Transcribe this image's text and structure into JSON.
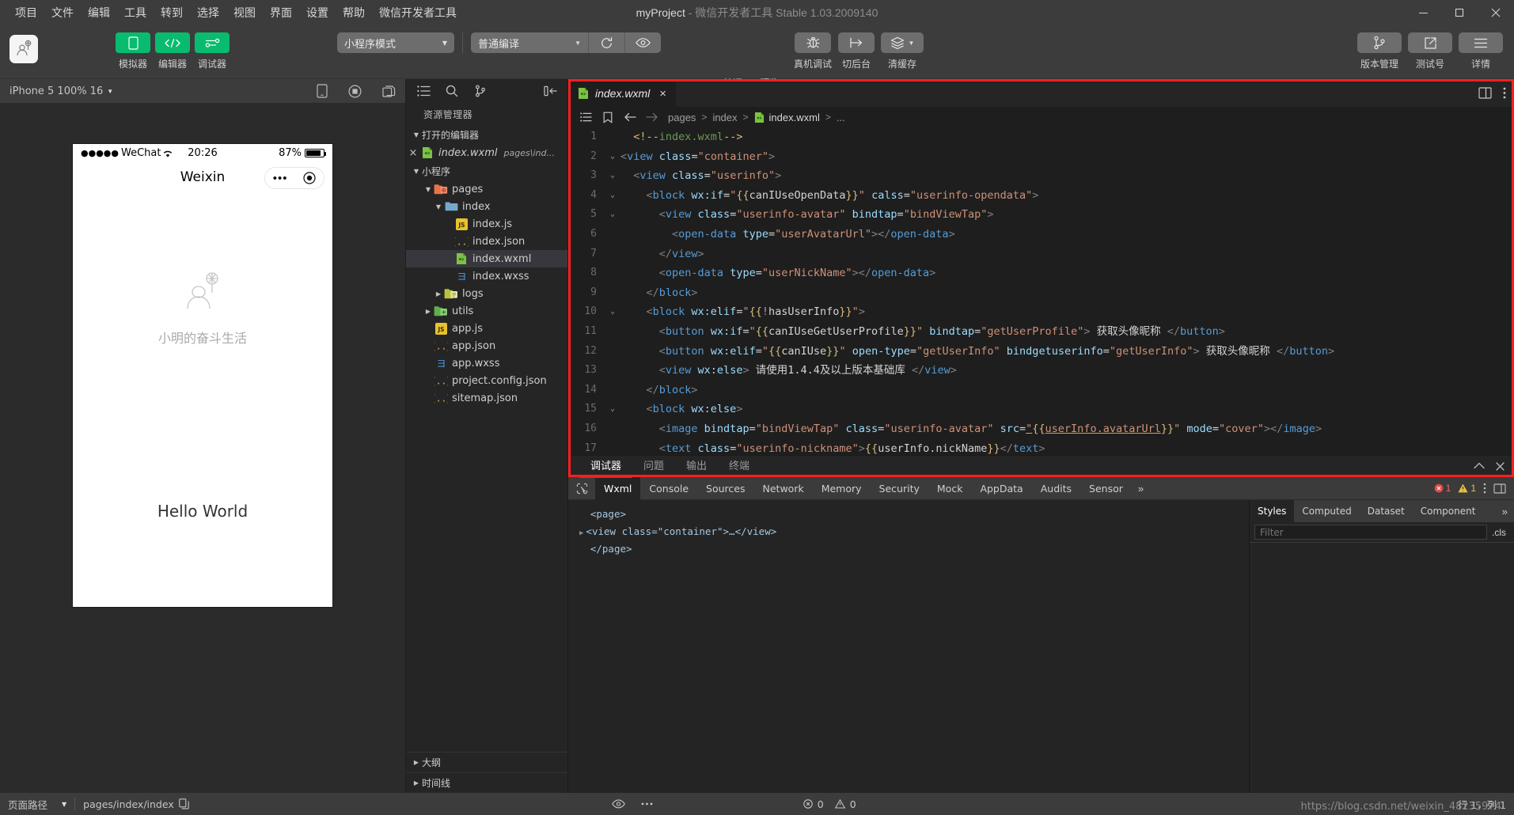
{
  "titlebar": {
    "menus": [
      "项目",
      "文件",
      "编辑",
      "工具",
      "转到",
      "选择",
      "视图",
      "界面",
      "设置",
      "帮助",
      "微信开发者工具"
    ],
    "project_name": "myProject",
    "dash": "-",
    "app_version": "微信开发者工具 Stable 1.03.2009140",
    "window_controls": {
      "minimize": "minimize-icon",
      "maximize": "maximize-icon",
      "close": "close-icon"
    }
  },
  "toolbar": {
    "logo": "project-avatar-icon",
    "modes": [
      {
        "label": "模拟器",
        "icon": "phone-icon"
      },
      {
        "label": "编辑器",
        "icon": "code-icon"
      },
      {
        "label": "调试器",
        "icon": "sliders-icon"
      }
    ],
    "mode_select": "小程序模式",
    "compile_select": "普通编译",
    "actions": [
      {
        "label": "编译",
        "icon": "refresh-icon"
      },
      {
        "label": "预览",
        "icon": "eye-icon"
      },
      {
        "label": "真机调试",
        "icon": "bug-icon"
      },
      {
        "label": "切后台",
        "icon": "background-icon"
      },
      {
        "label": "清缓存",
        "icon": "layers-icon"
      }
    ],
    "right_actions": [
      {
        "label": "版本管理",
        "icon": "branch-icon"
      },
      {
        "label": "测试号",
        "icon": "external-link-icon"
      },
      {
        "label": "详情",
        "icon": "menu-lines-icon"
      }
    ]
  },
  "simulator": {
    "device_label": "iPhone 5 100% 16",
    "icons": [
      "rotate-device-icon",
      "record-icon"
    ],
    "phone": {
      "status_dots": "●●●●●",
      "carrier": "WeChat",
      "wifi": "wifi-icon",
      "time": "20:26",
      "battery_percent": "87%",
      "nav_title": "Weixin",
      "capsule_more": "•••",
      "capsule_target": "target-icon",
      "nickname": "小明的奋斗生活",
      "body_text": "Hello World"
    }
  },
  "explorer": {
    "toolbar_icons": [
      "list-icon",
      "search-icon",
      "branch-icon",
      "collapse-icon"
    ],
    "title": "资源管理器",
    "open_editors": {
      "label": "打开的编辑器",
      "items": [
        {
          "name": "index.wxml",
          "path": "pages\\ind...",
          "icon": "wxml-icon",
          "close": "×"
        }
      ]
    },
    "project": {
      "label": "小程序",
      "tree": [
        {
          "name": "pages",
          "type": "folder-pages",
          "depth": 1,
          "expanded": true
        },
        {
          "name": "index",
          "type": "folder",
          "depth": 2,
          "expanded": true
        },
        {
          "name": "index.js",
          "type": "js",
          "depth": 3
        },
        {
          "name": "index.json",
          "type": "json",
          "depth": 3
        },
        {
          "name": "index.wxml",
          "type": "wxml",
          "depth": 3,
          "active": true
        },
        {
          "name": "index.wxss",
          "type": "wxss",
          "depth": 3
        },
        {
          "name": "logs",
          "type": "folder-logs",
          "depth": 2,
          "expanded": false
        },
        {
          "name": "utils",
          "type": "folder-utils",
          "depth": 1,
          "expanded": false
        },
        {
          "name": "app.js",
          "type": "js",
          "depth": 1
        },
        {
          "name": "app.json",
          "type": "json",
          "depth": 1
        },
        {
          "name": "app.wxss",
          "type": "wxss",
          "depth": 1
        },
        {
          "name": "project.config.json",
          "type": "json",
          "depth": 1
        },
        {
          "name": "sitemap.json",
          "type": "json",
          "depth": 1
        }
      ]
    },
    "bottom_sections": [
      "大纲",
      "时间线"
    ]
  },
  "editor": {
    "tab": {
      "name": "index.wxml",
      "icon": "wxml-icon",
      "close": "×"
    },
    "tab_actions": [
      "split-editor-icon",
      "more-icon"
    ],
    "breadcrumb": {
      "icons": [
        "outline-icon",
        "bookmark-icon",
        "back-arrow-icon",
        "forward-arrow-icon"
      ],
      "parts": [
        "pages",
        "index",
        "index.wxml",
        "..."
      ]
    },
    "lines": [
      {
        "n": "1",
        "fold": "",
        "tokens": [
          {
            "t": "  ",
            "c": "t-txt"
          },
          {
            "t": "<!--",
            "c": "t-com-b"
          },
          {
            "t": "index.wxml",
            "c": "t-com"
          },
          {
            "t": "-->",
            "c": "t-com-b"
          }
        ]
      },
      {
        "n": "2",
        "fold": "v",
        "tokens": [
          {
            "t": "<",
            "c": "t-pun"
          },
          {
            "t": "view",
            "c": "t-tag"
          },
          {
            "t": " class",
            "c": "t-attr"
          },
          {
            "t": "=",
            "c": "t-eq"
          },
          {
            "t": "\"container\"",
            "c": "t-str"
          },
          {
            "t": ">",
            "c": "t-pun"
          }
        ]
      },
      {
        "n": "3",
        "fold": "v",
        "tokens": [
          {
            "t": "  <",
            "c": "t-pun"
          },
          {
            "t": "view",
            "c": "t-tag"
          },
          {
            "t": " class",
            "c": "t-attr"
          },
          {
            "t": "=",
            "c": "t-eq"
          },
          {
            "t": "\"userinfo\"",
            "c": "t-str"
          },
          {
            "t": ">",
            "c": "t-pun"
          }
        ]
      },
      {
        "n": "4",
        "fold": "v",
        "tokens": [
          {
            "t": "    <",
            "c": "t-pun"
          },
          {
            "t": "block",
            "c": "t-tag"
          },
          {
            "t": " wx:if",
            "c": "t-attr"
          },
          {
            "t": "=",
            "c": "t-eq"
          },
          {
            "t": "\"",
            "c": "t-str"
          },
          {
            "t": "{{",
            "c": "t-brace"
          },
          {
            "t": "canIUseOpenData",
            "c": "t-txt"
          },
          {
            "t": "}}",
            "c": "t-brace"
          },
          {
            "t": "\"",
            "c": "t-str"
          },
          {
            "t": " calss",
            "c": "t-attr"
          },
          {
            "t": "=",
            "c": "t-eq"
          },
          {
            "t": "\"userinfo-opendata\"",
            "c": "t-str"
          },
          {
            "t": ">",
            "c": "t-pun"
          }
        ]
      },
      {
        "n": "5",
        "fold": "v",
        "tokens": [
          {
            "t": "      <",
            "c": "t-pun"
          },
          {
            "t": "view",
            "c": "t-tag"
          },
          {
            "t": " class",
            "c": "t-attr"
          },
          {
            "t": "=",
            "c": "t-eq"
          },
          {
            "t": "\"userinfo-avatar\"",
            "c": "t-str"
          },
          {
            "t": " bindtap",
            "c": "t-attr"
          },
          {
            "t": "=",
            "c": "t-eq"
          },
          {
            "t": "\"bindViewTap\"",
            "c": "t-str"
          },
          {
            "t": ">",
            "c": "t-pun"
          }
        ]
      },
      {
        "n": "6",
        "fold": "",
        "tokens": [
          {
            "t": "        <",
            "c": "t-pun"
          },
          {
            "t": "open-data",
            "c": "t-tag"
          },
          {
            "t": " type",
            "c": "t-attr"
          },
          {
            "t": "=",
            "c": "t-eq"
          },
          {
            "t": "\"userAvatarUrl\"",
            "c": "t-str"
          },
          {
            "t": "></",
            "c": "t-pun"
          },
          {
            "t": "open-data",
            "c": "t-tag"
          },
          {
            "t": ">",
            "c": "t-pun"
          }
        ]
      },
      {
        "n": "7",
        "fold": "",
        "tokens": [
          {
            "t": "      </",
            "c": "t-pun"
          },
          {
            "t": "view",
            "c": "t-tag"
          },
          {
            "t": ">",
            "c": "t-pun"
          }
        ]
      },
      {
        "n": "8",
        "fold": "",
        "tokens": [
          {
            "t": "      <",
            "c": "t-pun"
          },
          {
            "t": "open-data",
            "c": "t-tag"
          },
          {
            "t": " type",
            "c": "t-attr"
          },
          {
            "t": "=",
            "c": "t-eq"
          },
          {
            "t": "\"userNickName\"",
            "c": "t-str"
          },
          {
            "t": "></",
            "c": "t-pun"
          },
          {
            "t": "open-data",
            "c": "t-tag"
          },
          {
            "t": ">",
            "c": "t-pun"
          }
        ]
      },
      {
        "n": "9",
        "fold": "",
        "tokens": [
          {
            "t": "    </",
            "c": "t-pun"
          },
          {
            "t": "block",
            "c": "t-tag"
          },
          {
            "t": ">",
            "c": "t-pun"
          }
        ]
      },
      {
        "n": "10",
        "fold": "v",
        "tokens": [
          {
            "t": "    <",
            "c": "t-pun"
          },
          {
            "t": "block",
            "c": "t-tag"
          },
          {
            "t": " wx:elif",
            "c": "t-attr"
          },
          {
            "t": "=",
            "c": "t-eq"
          },
          {
            "t": "\"",
            "c": "t-str"
          },
          {
            "t": "{{",
            "c": "t-brace"
          },
          {
            "t": "!",
            "c": "t-var"
          },
          {
            "t": "hasUserInfo",
            "c": "t-txt"
          },
          {
            "t": "}}",
            "c": "t-brace"
          },
          {
            "t": "\"",
            "c": "t-str"
          },
          {
            "t": ">",
            "c": "t-pun"
          }
        ]
      },
      {
        "n": "11",
        "fold": "",
        "tokens": [
          {
            "t": "      <",
            "c": "t-pun"
          },
          {
            "t": "button",
            "c": "t-tag"
          },
          {
            "t": " wx:if",
            "c": "t-attr"
          },
          {
            "t": "=",
            "c": "t-eq"
          },
          {
            "t": "\"",
            "c": "t-str"
          },
          {
            "t": "{{",
            "c": "t-brace"
          },
          {
            "t": "canIUseGetUserProfile",
            "c": "t-txt"
          },
          {
            "t": "}}",
            "c": "t-brace"
          },
          {
            "t": "\"",
            "c": "t-str"
          },
          {
            "t": " bindtap",
            "c": "t-attr"
          },
          {
            "t": "=",
            "c": "t-eq"
          },
          {
            "t": "\"getUserProfile\"",
            "c": "t-str"
          },
          {
            "t": ">",
            "c": "t-pun"
          },
          {
            "t": " 获取头像昵称 ",
            "c": "t-txt"
          },
          {
            "t": "</",
            "c": "t-pun"
          },
          {
            "t": "button",
            "c": "t-tag"
          },
          {
            "t": ">",
            "c": "t-pun"
          }
        ]
      },
      {
        "n": "12",
        "fold": "",
        "tokens": [
          {
            "t": "      <",
            "c": "t-pun"
          },
          {
            "t": "button",
            "c": "t-tag"
          },
          {
            "t": " wx:elif",
            "c": "t-attr"
          },
          {
            "t": "=",
            "c": "t-eq"
          },
          {
            "t": "\"",
            "c": "t-str"
          },
          {
            "t": "{{",
            "c": "t-brace"
          },
          {
            "t": "canIUse",
            "c": "t-txt"
          },
          {
            "t": "}}",
            "c": "t-brace"
          },
          {
            "t": "\"",
            "c": "t-str"
          },
          {
            "t": " open-type",
            "c": "t-attr"
          },
          {
            "t": "=",
            "c": "t-eq"
          },
          {
            "t": "\"getUserInfo\"",
            "c": "t-str"
          },
          {
            "t": " bindgetuserinfo",
            "c": "t-attr"
          },
          {
            "t": "=",
            "c": "t-eq"
          },
          {
            "t": "\"getUserInfo\"",
            "c": "t-str"
          },
          {
            "t": ">",
            "c": "t-pun"
          },
          {
            "t": " 获取头像昵称 ",
            "c": "t-txt"
          },
          {
            "t": "</",
            "c": "t-pun"
          },
          {
            "t": "button",
            "c": "t-tag"
          },
          {
            "t": ">",
            "c": "t-pun"
          }
        ]
      },
      {
        "n": "13",
        "fold": "",
        "tokens": [
          {
            "t": "      <",
            "c": "t-pun"
          },
          {
            "t": "view",
            "c": "t-tag"
          },
          {
            "t": " wx:else",
            "c": "t-attr"
          },
          {
            "t": ">",
            "c": "t-pun"
          },
          {
            "t": " 请使用1.4.4及以上版本基础库 ",
            "c": "t-txt"
          },
          {
            "t": "</",
            "c": "t-pun"
          },
          {
            "t": "view",
            "c": "t-tag"
          },
          {
            "t": ">",
            "c": "t-pun"
          }
        ]
      },
      {
        "n": "14",
        "fold": "",
        "tokens": [
          {
            "t": "    </",
            "c": "t-pun"
          },
          {
            "t": "block",
            "c": "t-tag"
          },
          {
            "t": ">",
            "c": "t-pun"
          }
        ]
      },
      {
        "n": "15",
        "fold": "v",
        "tokens": [
          {
            "t": "    <",
            "c": "t-pun"
          },
          {
            "t": "block",
            "c": "t-tag"
          },
          {
            "t": " wx:else",
            "c": "t-attr"
          },
          {
            "t": ">",
            "c": "t-pun"
          }
        ]
      },
      {
        "n": "16",
        "fold": "",
        "tokens": [
          {
            "t": "      <",
            "c": "t-pun"
          },
          {
            "t": "image",
            "c": "t-tag"
          },
          {
            "t": " bindtap",
            "c": "t-attr"
          },
          {
            "t": "=",
            "c": "t-eq"
          },
          {
            "t": "\"bindViewTap\"",
            "c": "t-str"
          },
          {
            "t": " class",
            "c": "t-attr"
          },
          {
            "t": "=",
            "c": "t-eq"
          },
          {
            "t": "\"userinfo-avatar\"",
            "c": "t-str"
          },
          {
            "t": " src",
            "c": "t-attr"
          },
          {
            "t": "=",
            "c": "t-eq"
          },
          {
            "t": "\"",
            "c": "t-link"
          },
          {
            "t": "{{",
            "c": "t-brace"
          },
          {
            "t": "userInfo.avatarUrl",
            "c": "t-link"
          },
          {
            "t": "}}",
            "c": "t-brace"
          },
          {
            "t": "\"",
            "c": "t-str"
          },
          {
            "t": " mode",
            "c": "t-attr"
          },
          {
            "t": "=",
            "c": "t-eq"
          },
          {
            "t": "\"cover\"",
            "c": "t-str"
          },
          {
            "t": "></",
            "c": "t-pun"
          },
          {
            "t": "image",
            "c": "t-tag"
          },
          {
            "t": ">",
            "c": "t-pun"
          }
        ]
      },
      {
        "n": "17",
        "fold": "",
        "tokens": [
          {
            "t": "      <",
            "c": "t-pun"
          },
          {
            "t": "text",
            "c": "t-tag"
          },
          {
            "t": " class",
            "c": "t-attr"
          },
          {
            "t": "=",
            "c": "t-eq"
          },
          {
            "t": "\"userinfo-nickname\"",
            "c": "t-str"
          },
          {
            "t": ">",
            "c": "t-pun"
          },
          {
            "t": "{{",
            "c": "t-brace"
          },
          {
            "t": "userInfo.nickName",
            "c": "t-txt"
          },
          {
            "t": "}}",
            "c": "t-brace"
          },
          {
            "t": "</",
            "c": "t-pun"
          },
          {
            "t": "text",
            "c": "t-tag"
          },
          {
            "t": ">",
            "c": "t-pun"
          }
        ]
      }
    ]
  },
  "panel": {
    "tabs": [
      "调试器",
      "问题",
      "输出",
      "终端"
    ],
    "active_tab": "调试器",
    "actions": [
      "chevron-up-icon",
      "close-icon"
    ]
  },
  "devtools": {
    "inspect_icon": "inspect-element-icon",
    "tabs": [
      "Wxml",
      "Console",
      "Sources",
      "Network",
      "Memory",
      "Security",
      "Mock",
      "AppData",
      "Audits",
      "Sensor"
    ],
    "active_tab": "Wxml",
    "overflow": "»",
    "error_count": "1",
    "warning_count": "1",
    "more_icon": "kebab-icon",
    "dock_icon": "dock-icon",
    "dom": [
      {
        "indent": 0,
        "arrow": "",
        "text": "<page>",
        "cls": "t-tag"
      },
      {
        "indent": 0,
        "arrow": "▶",
        "text": "<view class=\"container\">…</view>",
        "cls": "t-tag"
      },
      {
        "indent": 0,
        "arrow": "",
        "text": "</page>",
        "cls": "t-tag"
      }
    ],
    "styles_panel": {
      "tabs": [
        "Styles",
        "Computed",
        "Dataset",
        "Component Data"
      ],
      "active_tab": "Styles",
      "overflow": "»",
      "filter_placeholder": "Filter",
      "cls_button": ".cls"
    }
  },
  "statusbar": {
    "page_path_label": "页面路径",
    "page_path": "pages/index/index",
    "copy_icon": "copy-icon",
    "eye_icon": "eye-icon",
    "more_icon": "ellipsis-icon",
    "error_count": "0",
    "warning_count": "0",
    "cursor_position": "行 1，列 1",
    "watermark": "https://blog.csdn.net/weixin_48235974"
  }
}
